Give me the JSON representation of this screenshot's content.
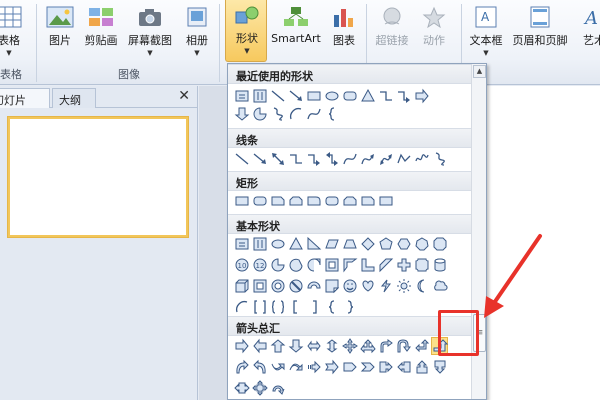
{
  "ribbon": {
    "groups": [
      {
        "label": "表格"
      },
      {
        "label": "图像"
      }
    ],
    "buttons": {
      "table": "表格",
      "picture": "图片",
      "clipart": "剪贴画",
      "screenshot": "屏幕截图",
      "album": "相册",
      "shapes": "形状",
      "smartart": "SmartArt",
      "chart": "图表",
      "hyperlink": "超链接",
      "action": "动作",
      "textbox": "文本框",
      "header_footer": "页眉和页脚",
      "wordart": "艺术"
    }
  },
  "left_panel": {
    "tabs": [
      "幻灯片",
      "大纲"
    ],
    "close": "✕"
  },
  "gallery": {
    "sections": [
      "最近使用的形状",
      "线条",
      "矩形",
      "基本形状",
      "箭头总汇"
    ],
    "highlighted_shape": "arrow-bent-up"
  },
  "colors": {
    "accent": "#f7c95e",
    "annotation": "#e8322a"
  }
}
